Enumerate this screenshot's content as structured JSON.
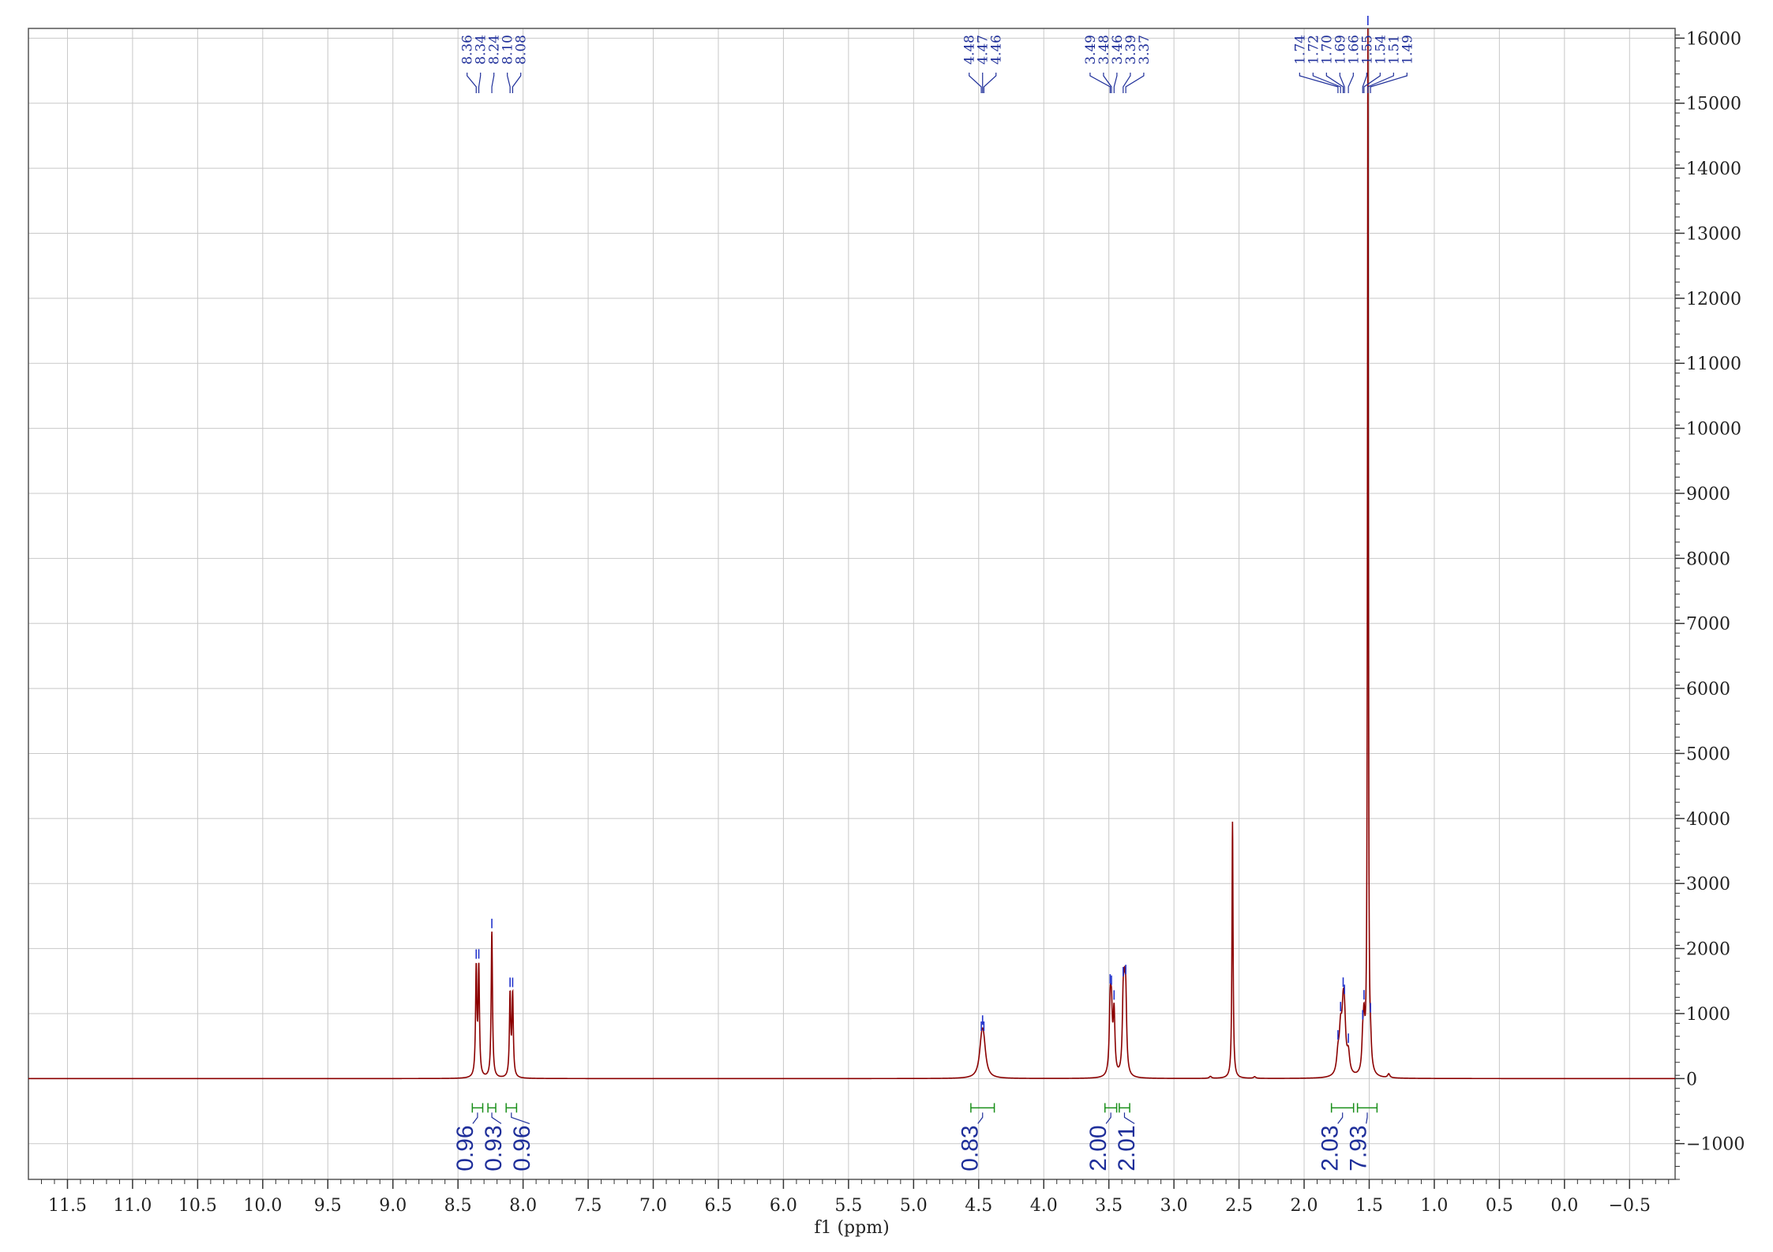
{
  "chart_data": {
    "type": "line",
    "title": "",
    "xlabel": "f1 (ppm)",
    "ylabel": "",
    "xlim": [
      11.8,
      -0.85
    ],
    "ylim": [
      -1550,
      16150
    ],
    "x_reversed": true,
    "grid": true,
    "y_axis_side": "right",
    "x_ticks": [
      11.5,
      11.0,
      10.5,
      10.0,
      9.5,
      9.0,
      8.5,
      8.0,
      7.5,
      7.0,
      6.5,
      6.0,
      5.5,
      5.0,
      4.5,
      4.0,
      3.5,
      3.0,
      2.5,
      2.0,
      1.5,
      1.0,
      0.5,
      0.0,
      -0.5
    ],
    "x_tick_labels": [
      "11.5",
      "11.0",
      "10.5",
      "10.0",
      "9.5",
      "9.0",
      "8.5",
      "8.0",
      "7.5",
      "7.0",
      "6.5",
      "6.0",
      "5.5",
      "5.0",
      "4.5",
      "4.0",
      "3.5",
      "3.0",
      "2.5",
      "2.0",
      "1.5",
      "1.0",
      "0.5",
      "0.0",
      "−0.5"
    ],
    "y_ticks": [
      16000,
      15000,
      14000,
      13000,
      12000,
      11000,
      10000,
      9000,
      8000,
      7000,
      6000,
      5000,
      4000,
      3000,
      2000,
      1000,
      0,
      -1000
    ],
    "y_tick_labels": [
      "16000",
      "15000",
      "14000",
      "13000",
      "12000",
      "11000",
      "10000",
      "9000",
      "8000",
      "7000",
      "6000",
      "5000",
      "4000",
      "3000",
      "2000",
      "1000",
      "0",
      "−1000"
    ],
    "series": [
      {
        "color": "#8b0000",
        "peaks": [
          {
            "ppm": 8.36,
            "height": 1650,
            "width": 0.006
          },
          {
            "ppm": 8.34,
            "height": 1650,
            "width": 0.006
          },
          {
            "ppm": 8.24,
            "height": 2250,
            "width": 0.006
          },
          {
            "ppm": 8.1,
            "height": 1250,
            "width": 0.006
          },
          {
            "ppm": 8.08,
            "height": 1250,
            "width": 0.006
          },
          {
            "ppm": 4.48,
            "height": 280,
            "width": 0.02
          },
          {
            "ppm": 4.47,
            "height": 330,
            "width": 0.02
          },
          {
            "ppm": 4.46,
            "height": 280,
            "width": 0.02
          },
          {
            "ppm": 3.49,
            "height": 1000,
            "width": 0.008
          },
          {
            "ppm": 3.48,
            "height": 850,
            "width": 0.008
          },
          {
            "ppm": 3.46,
            "height": 950,
            "width": 0.008
          },
          {
            "ppm": 3.39,
            "height": 1000,
            "width": 0.008
          },
          {
            "ppm": 3.38,
            "height": 900,
            "width": 0.008
          },
          {
            "ppm": 3.37,
            "height": 1050,
            "width": 0.008
          },
          {
            "ppm": 2.55,
            "height": 3950,
            "width": 0.005
          },
          {
            "ppm": 1.74,
            "height": 280,
            "width": 0.012
          },
          {
            "ppm": 1.72,
            "height": 600,
            "width": 0.012
          },
          {
            "ppm": 1.7,
            "height": 760,
            "width": 0.012
          },
          {
            "ppm": 1.69,
            "height": 650,
            "width": 0.012
          },
          {
            "ppm": 1.66,
            "height": 300,
            "width": 0.012
          },
          {
            "ppm": 1.55,
            "height": 400,
            "width": 0.008
          },
          {
            "ppm": 1.54,
            "height": 700,
            "width": 0.008
          },
          {
            "ppm": 1.51,
            "height": 16500,
            "width": 0.004
          },
          {
            "ppm": 1.49,
            "height": 300,
            "width": 0.008
          },
          {
            "ppm": 1.35,
            "height": 60,
            "width": 0.01
          },
          {
            "ppm": 2.72,
            "height": 30,
            "width": 0.01
          },
          {
            "ppm": 2.38,
            "height": 25,
            "width": 0.01
          }
        ]
      }
    ],
    "peak_labels": {
      "color": "#1f2f9a",
      "groups": [
        {
          "labels": [
            "8.36",
            "8.34",
            "8.24",
            "8.10",
            "8.08"
          ],
          "ppms": [
            8.36,
            8.34,
            8.24,
            8.1,
            8.08
          ]
        },
        {
          "labels": [
            "4.48",
            "4.47",
            "4.46"
          ],
          "ppms": [
            4.48,
            4.47,
            4.46
          ]
        },
        {
          "labels": [
            "3.49",
            "3.48",
            "3.46",
            "3.39",
            "3.37"
          ],
          "ppms": [
            3.49,
            3.48,
            3.46,
            3.39,
            3.37
          ]
        },
        {
          "labels": [
            "1.74",
            "1.72",
            "1.70",
            "1.69",
            "1.66",
            "1.55",
            "1.54",
            "1.51",
            "1.49"
          ],
          "ppms": [
            1.74,
            1.72,
            1.7,
            1.69,
            1.66,
            1.55,
            1.54,
            1.51,
            1.49
          ]
        }
      ]
    },
    "integrals": {
      "color": "#1a8f1a",
      "label_color": "#1f2f9a",
      "items": [
        {
          "label": "0.96",
          "from": 8.39,
          "to": 8.31
        },
        {
          "label": "0.93",
          "from": 8.27,
          "to": 8.21
        },
        {
          "label": "0.96",
          "from": 8.13,
          "to": 8.05
        },
        {
          "label": "0.83",
          "from": 4.56,
          "to": 4.38
        },
        {
          "label": "2.00",
          "from": 3.53,
          "to": 3.44
        },
        {
          "label": "2.01",
          "from": 3.42,
          "to": 3.34
        },
        {
          "label": "2.03",
          "from": 1.79,
          "to": 1.62
        },
        {
          "label": "7.93",
          "from": 1.59,
          "to": 1.44
        }
      ]
    }
  }
}
